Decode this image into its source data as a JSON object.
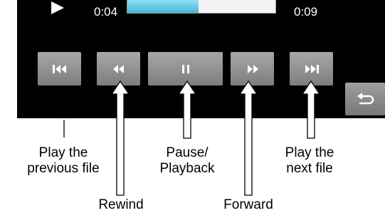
{
  "player": {
    "current_time": "0:04",
    "total_time": "0:09",
    "progress_fraction": 0.48
  },
  "buttons": {
    "prev_icon": "skip-previous-icon",
    "rewind_icon": "rewind-icon",
    "pause_icon": "pause-icon",
    "forward_icon": "fast-forward-icon",
    "next_icon": "skip-next-icon",
    "back_icon": "return-arrow-icon"
  },
  "callouts": {
    "previous": [
      "Play the",
      "previous file"
    ],
    "rewind": "Rewind",
    "pause": [
      "Pause/",
      "Playback"
    ],
    "forward": "Forward",
    "next": [
      "Play the",
      "next file"
    ]
  },
  "colors": {
    "screen_bg": "#000000",
    "button": "#8e8e8e",
    "progress_fill": "#5bc3df"
  }
}
